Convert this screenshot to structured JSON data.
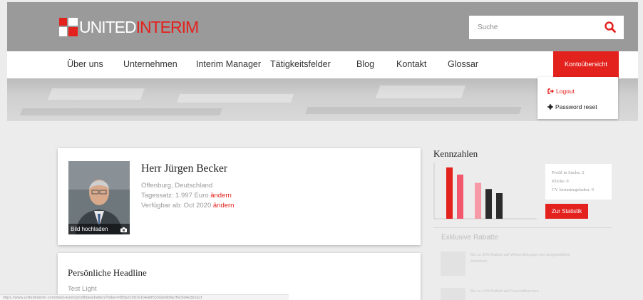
{
  "header": {
    "logo": {
      "part1": "UNITED",
      "part2": "INTERIM"
    },
    "search": {
      "placeholder": "Suche"
    }
  },
  "nav": {
    "items": [
      {
        "label": "Über uns"
      },
      {
        "label": "Unternehmen"
      },
      {
        "label": "Interim Manager"
      },
      {
        "label": "Tätigkeitsfelder"
      },
      {
        "label": "Blog"
      },
      {
        "label": "Kontakt"
      },
      {
        "label": "Glossar"
      }
    ],
    "account_label": "Kontoübersicht"
  },
  "dropdown": {
    "logout": "Logout",
    "password_reset": "Password reset"
  },
  "profile": {
    "photo_caption": "Bild hochladen",
    "name": "Herr Jürgen Becker",
    "location": "Offenburg, Deutschland",
    "rate_label": "Tagessatz: 1.997 Euro",
    "available_label": "Verfügbar ab: Oct 2020",
    "change_link": "ändern"
  },
  "headline": {
    "title": "Persönliche Headline",
    "text": "Test Light"
  },
  "kennzahlen": {
    "title": "Kennzahlen",
    "stats": [
      "Profil in Suche: 2",
      "Klicks: 0",
      "CV heruntergeladen: 0"
    ],
    "button": "Zur Statistik"
  },
  "chart_data": {
    "type": "bar",
    "values": [
      100,
      86,
      70,
      58,
      50
    ],
    "colors": [
      "#e3211d",
      "#f2576d",
      "#f59aa6",
      "#2b2b2b",
      "#2b2b2b"
    ]
  },
  "rabatte": {
    "title": "Exklusive Rabatte",
    "items": [
      {
        "text": "Bis zu 30% Rabatt auf Weiterbildungen bei ausgewählten Anbietern"
      },
      {
        "text": "Bis zu 15% Rabatt auf Geschäftsreisen"
      }
    ]
  },
  "statusbar": {
    "url": "https://www.unitedinterim.com/mein-konto/profil/bearbeiten/?token=8f3a2c9d7e1b4a6f5c0d2e9b8a7f6c5d4e3b2a1f"
  },
  "colors": {
    "brand_red": "#e3211d",
    "header_gray": "#9a9a9a"
  }
}
